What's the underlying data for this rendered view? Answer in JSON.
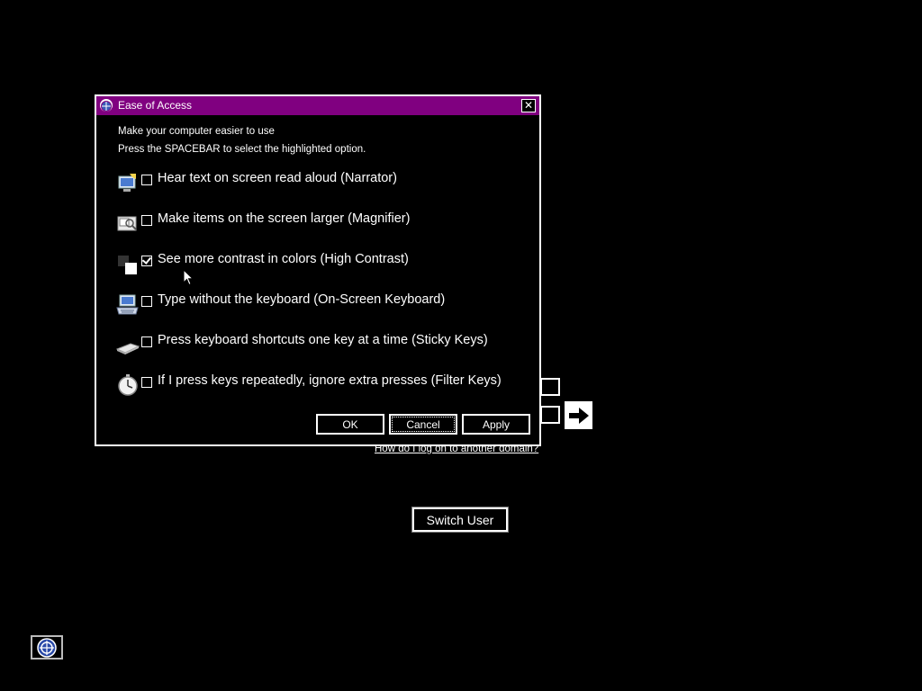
{
  "dialog": {
    "title": "Ease of Access",
    "close_glyph": "✕",
    "subtitle1": "Make your computer easier to use",
    "subtitle2": "Press the SPACEBAR to select the highlighted option.",
    "options": [
      {
        "label": "Hear text on screen read aloud (Narrator)",
        "checked": false,
        "icon": "narrator-icon"
      },
      {
        "label": "Make items on the screen larger (Magnifier)",
        "checked": false,
        "icon": "magnifier-icon"
      },
      {
        "label": "See more contrast in colors (High Contrast)",
        "checked": true,
        "icon": "high-contrast-icon"
      },
      {
        "label": "Type without the keyboard (On-Screen Keyboard)",
        "checked": false,
        "icon": "keyboard-icon"
      },
      {
        "label": "Press keyboard shortcuts one key at a time (Sticky Keys)",
        "checked": false,
        "icon": "sticky-keys-icon"
      },
      {
        "label": "If I press keys repeatedly, ignore extra presses (Filter Keys)",
        "checked": false,
        "icon": "filter-keys-icon"
      }
    ],
    "buttons": {
      "ok": "OK",
      "cancel": "Cancel",
      "apply": "Apply"
    }
  },
  "logon": {
    "domain_link": "How do I log on to another domain?",
    "switch_user": "Switch User"
  },
  "colors": {
    "titlebar": "#800080",
    "background": "#000000",
    "foreground": "#ffffff"
  }
}
